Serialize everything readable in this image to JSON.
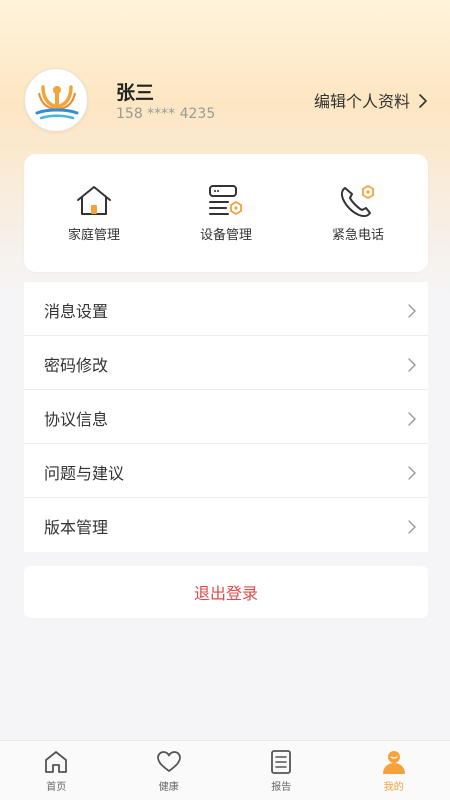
{
  "profile": {
    "name": "张三",
    "phone": "158 **** 4235",
    "edit_label": "编辑个人资料"
  },
  "quick_actions": [
    {
      "label": "家庭管理",
      "icon": "home-icon"
    },
    {
      "label": "设备管理",
      "icon": "device-icon"
    },
    {
      "label": "紧急电话",
      "icon": "phone-icon"
    }
  ],
  "menu": [
    {
      "label": "消息设置"
    },
    {
      "label": "密码修改"
    },
    {
      "label": "协议信息"
    },
    {
      "label": "问题与建议"
    },
    {
      "label": "版本管理"
    }
  ],
  "logout_label": "退出登录",
  "tabs": [
    {
      "label": "首页",
      "icon": "home-outline-icon",
      "active": false
    },
    {
      "label": "健康",
      "icon": "heart-icon",
      "active": false
    },
    {
      "label": "报告",
      "icon": "report-icon",
      "active": false
    },
    {
      "label": "我的",
      "icon": "user-icon",
      "active": true
    }
  ],
  "colors": {
    "accent": "#f5a23a",
    "danger": "#e24a4a"
  }
}
